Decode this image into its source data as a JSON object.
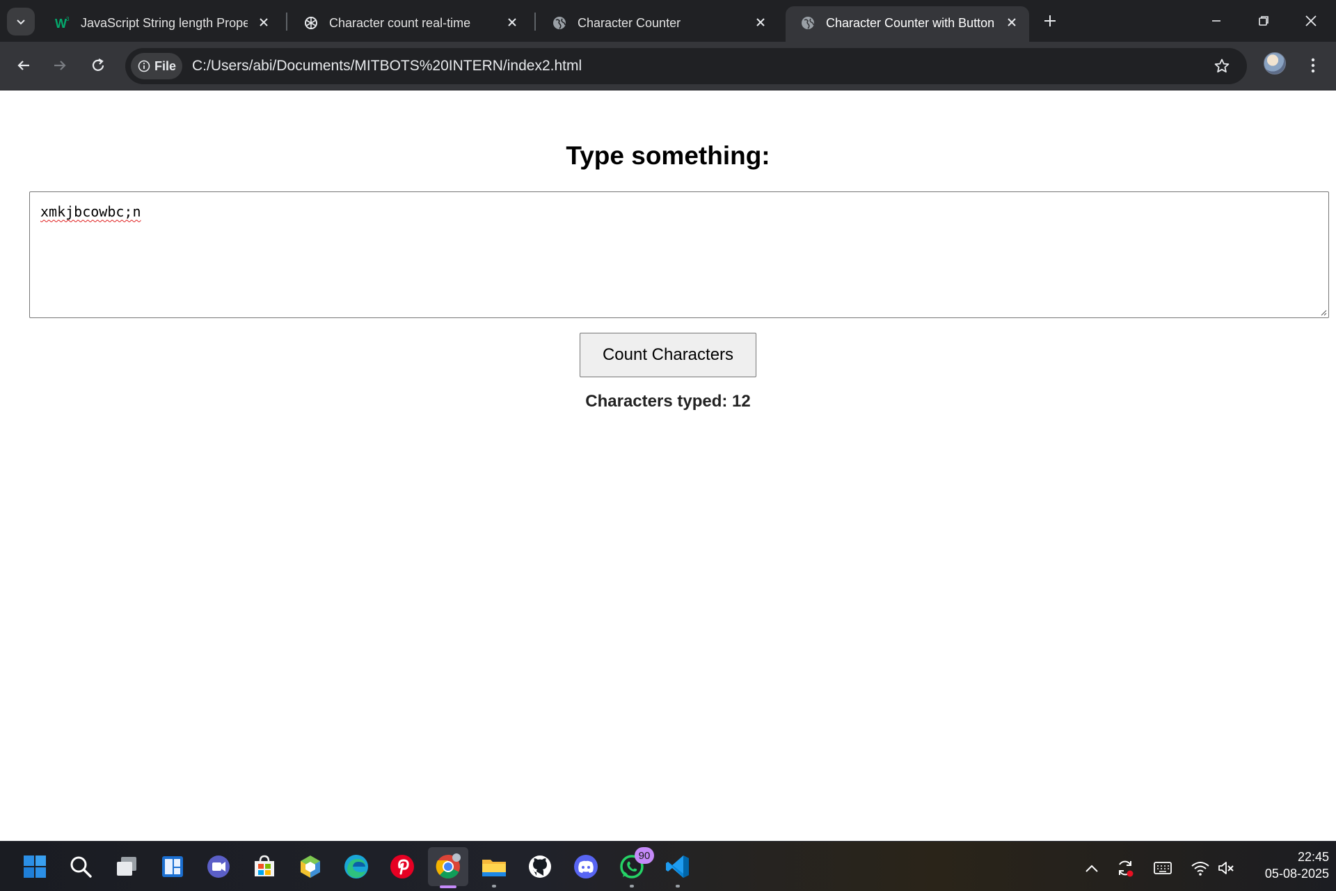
{
  "browser": {
    "tabs": [
      {
        "title": "JavaScript String length Propert",
        "favicon": "w3schools-icon",
        "active": false
      },
      {
        "title": "Character count real-time",
        "favicon": "chatgpt-icon",
        "active": false
      },
      {
        "title": "Character Counter",
        "favicon": "globe-icon",
        "active": false
      },
      {
        "title": "Character Counter with Button",
        "favicon": "globe-icon",
        "active": true
      }
    ],
    "address_bar": {
      "scheme_chip": "File",
      "url": "C:/Users/abi/Documents/MITBOTS%20INTERN/index2.html"
    }
  },
  "page": {
    "heading": "Type something:",
    "textarea_value": "xmkjbcowbc;n",
    "button_label": "Count Characters",
    "result_text": "Characters typed: 12"
  },
  "taskbar": {
    "apps": [
      "start-icon",
      "search-icon",
      "task-view-icon",
      "widgets-icon",
      "teams-icon",
      "store-icon",
      "app-cube-icon",
      "edge-icon",
      "pinterest-icon",
      "chrome-icon",
      "file-explorer-icon",
      "github-icon",
      "discord-icon",
      "whatsapp-icon",
      "vscode-icon"
    ],
    "whatsapp_badge": "90",
    "clock_time": "22:45",
    "clock_date": "05-08-2025"
  },
  "colors": {
    "tabstrip": "#202124",
    "toolbar": "#35363a",
    "accent": "#c58af9",
    "spellcheck": "#e02020"
  }
}
